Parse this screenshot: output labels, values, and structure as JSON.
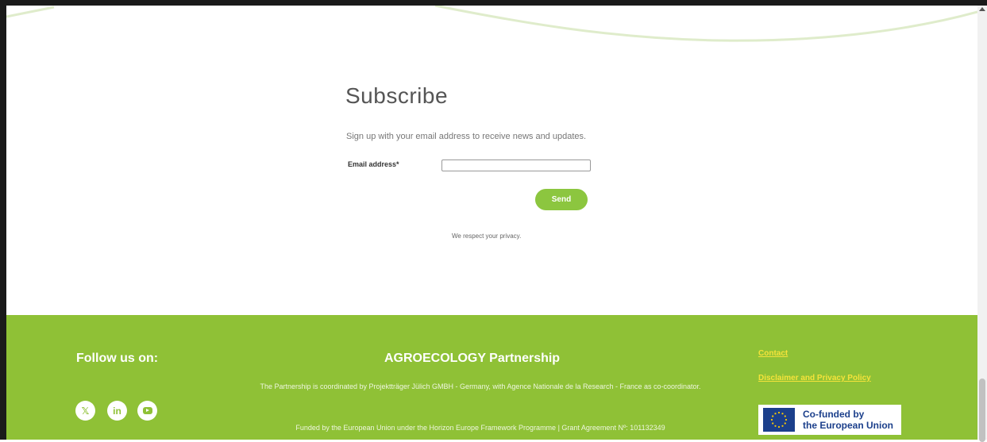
{
  "subscribe": {
    "title": "Subscribe",
    "description": "Sign up with your email address to receive news and updates.",
    "email_label": "Email address*",
    "email_value": "",
    "send_label": "Send",
    "privacy_note": "We respect your privacy."
  },
  "footer": {
    "follow_title": "Follow us on:",
    "social_icons": [
      "x-icon",
      "linkedin-icon",
      "youtube-icon"
    ],
    "linkedin_glyph": "in",
    "x_glyph": "𝕏",
    "partnership_title": "AGROECOLOGY Partnership",
    "partnership_text": "The Partnership is coordinated by Projektträger Jülich GMBH - Germany, with Agence Nationale de la Research - France as co-coordinator.",
    "funding_text": "Funded by the European Union under the Horizon Europe Framework Programme | Grant Agreement Nº: 101132349",
    "links": {
      "contact": "Contact",
      "disclaimer": "Disclaimer and Privacy Policy"
    },
    "eu_badge": {
      "line1": "Co-funded by",
      "line2": "the European Union"
    }
  },
  "colors": {
    "brand_green": "#8fc136",
    "button_green": "#8cc63f",
    "link_yellow": "#f5e33a",
    "eu_blue": "#1b3f8b",
    "eu_star_yellow": "#ffcc00"
  }
}
